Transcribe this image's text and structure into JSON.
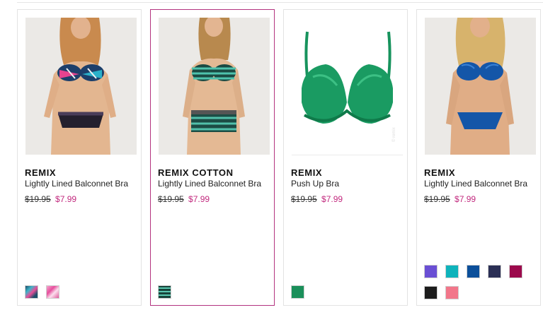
{
  "products": [
    {
      "brand": "REMIX",
      "name": "Lightly Lined Balconnet Bra",
      "original_price": "$19.95",
      "sale_price": "$7.99",
      "image": "model wearing tie-dye print bra and black lace-trim panty",
      "swatches": [
        {
          "color": "#2b6f85",
          "pattern": "tie-dye-teal"
        },
        {
          "color": "#e879b7",
          "pattern": "tie-dye-pink"
        }
      ]
    },
    {
      "brand": "REMIX COTTON",
      "name": "Lightly Lined Balconnet Bra",
      "original_price": "$19.95",
      "sale_price": "$7.99",
      "image": "model wearing teal striped bra and boyshort",
      "swatches": [
        {
          "color": "#1f5a4c",
          "pattern": "stripe-green"
        }
      ]
    },
    {
      "brand": "REMIX",
      "name": "Push Up Bra",
      "original_price": "$19.95",
      "sale_price": "$7.99",
      "image": "green push up bra product shot",
      "swatches": [
        {
          "color": "#1a8f5a",
          "pattern": "solid"
        }
      ]
    },
    {
      "brand": "REMIX",
      "name": "Lightly Lined Balconnet Bra",
      "original_price": "$19.95",
      "sale_price": "$7.99",
      "image": "model wearing cobalt blue bra and panty",
      "swatches": [
        {
          "color": "#6a4fd4",
          "pattern": "solid"
        },
        {
          "color": "#0fb3bb",
          "pattern": "solid"
        },
        {
          "color": "#0b4f9a",
          "pattern": "solid"
        },
        {
          "color": "#2b2f55",
          "pattern": "solid"
        },
        {
          "color": "#9c0a4c",
          "pattern": "solid"
        },
        {
          "color": "#1c1c1c",
          "pattern": "solid"
        },
        {
          "color": "#f2768a",
          "pattern": "solid"
        }
      ]
    }
  ],
  "colors": {
    "sale_price": "#c2297e",
    "selected_border": "#b3337f",
    "card_border": "#e3e3e3"
  }
}
